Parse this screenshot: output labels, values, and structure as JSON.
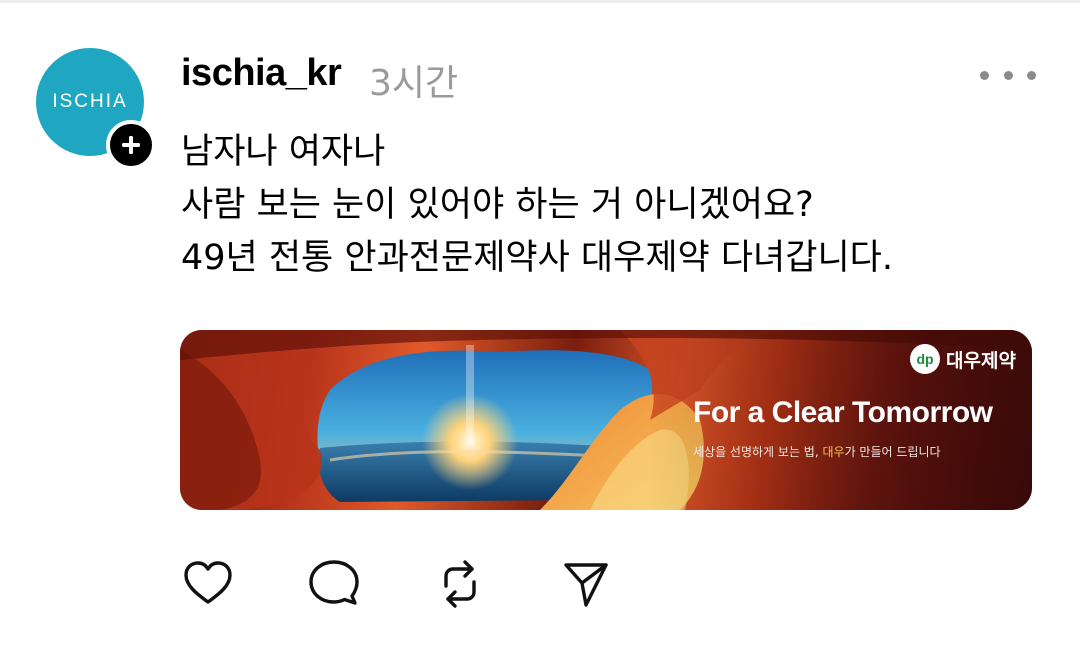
{
  "post": {
    "author": {
      "username": "ischia_kr",
      "avatar_text": "ISCHIA",
      "avatar_color": "#1fa7c2",
      "follow_icon": "plus-icon"
    },
    "timestamp": "3시간",
    "more_icon": "more-horizontal-icon",
    "body_lines": [
      "남자나 여자나",
      "사람 보는 눈이 있어야 하는 거 아니겠어요?",
      "49년 전통 안과전문제약사 대우제약 다녀갑니다."
    ],
    "banner": {
      "logo_mark": "dp",
      "brand_name": "대우제약",
      "headline": "For a Clear Tomorrow",
      "tagline_before": "세상을 선명하게 보는 법, ",
      "tagline_brand": "대우",
      "tagline_after": "가 만들어 드립니다"
    },
    "actions": [
      {
        "name": "like",
        "icon": "heart-icon"
      },
      {
        "name": "comment",
        "icon": "comment-icon"
      },
      {
        "name": "repost",
        "icon": "repost-icon"
      },
      {
        "name": "share",
        "icon": "send-icon"
      }
    ]
  },
  "colors": {
    "text": "#000000",
    "muted": "#9a9a9a",
    "brand_green": "#1c8a3a",
    "tagline_accent": "#f2c84a"
  }
}
